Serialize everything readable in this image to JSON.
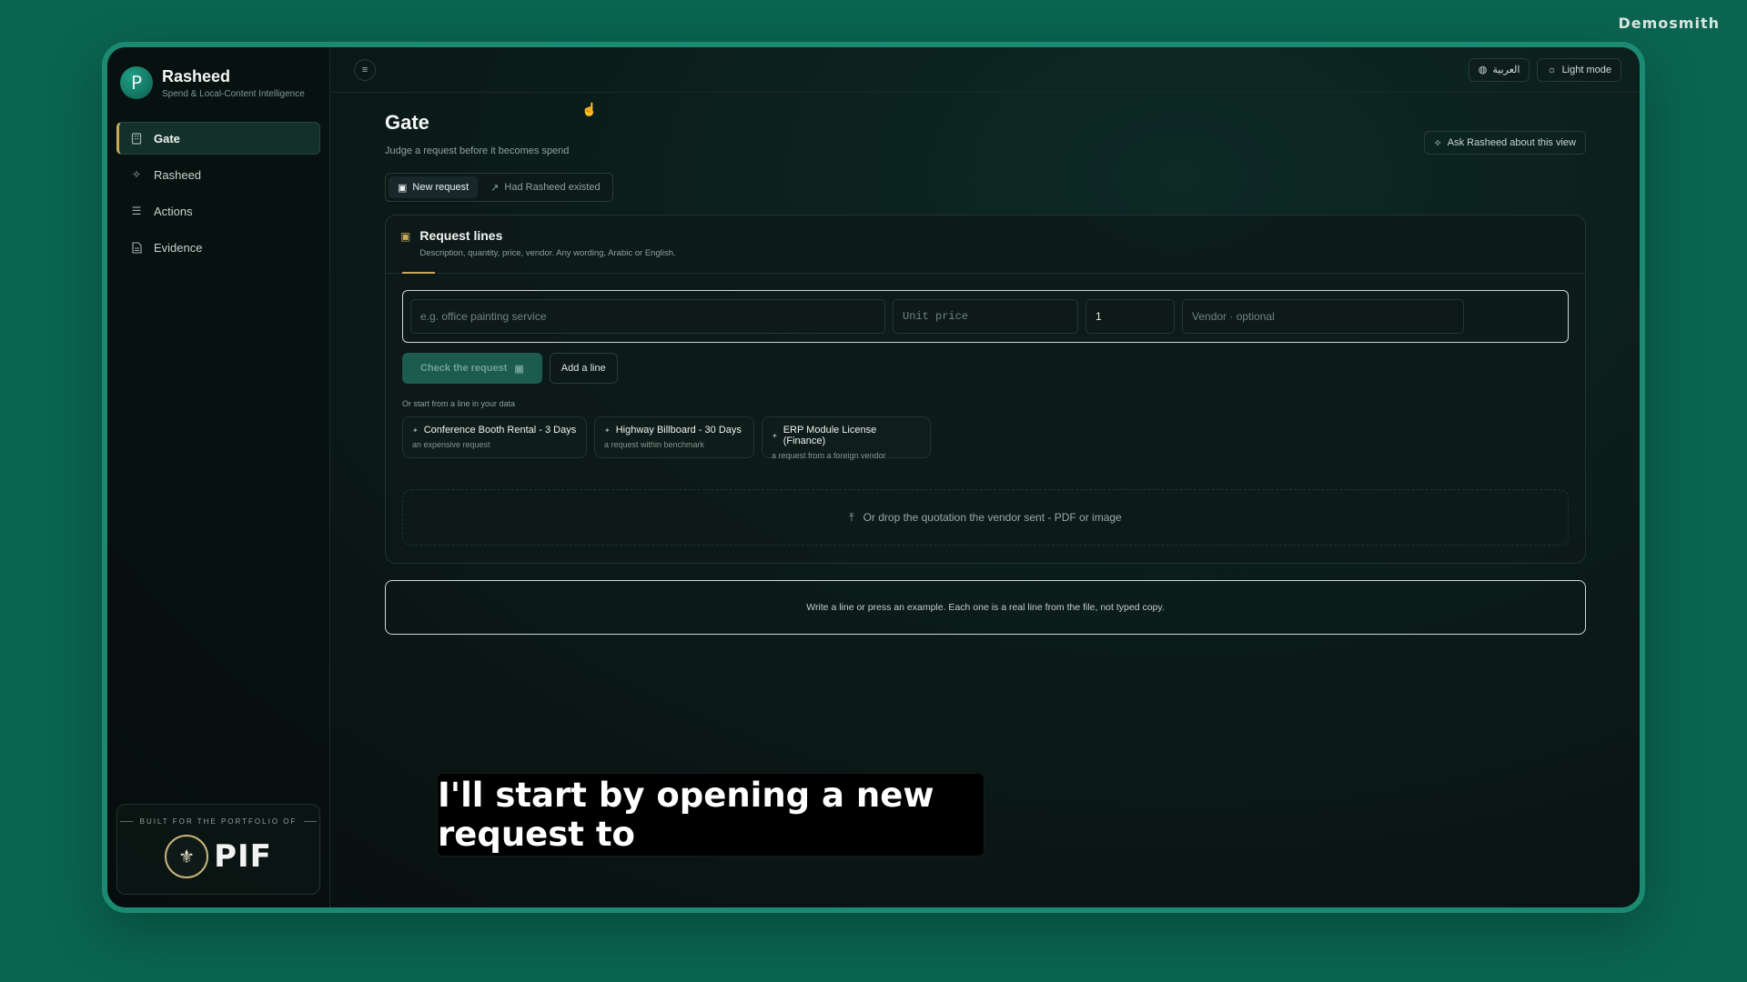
{
  "watermark": "Demosmith",
  "brand": {
    "initial": "P",
    "name": "Rasheed",
    "subtitle": "Spend & Local-Content Intelligence"
  },
  "sidebar": {
    "items": [
      {
        "label": "Gate",
        "icon": "building-icon",
        "active": true
      },
      {
        "label": "Rasheed",
        "icon": "sparkle-icon",
        "active": false
      },
      {
        "label": "Actions",
        "icon": "list-filter-icon",
        "active": false
      },
      {
        "label": "Evidence",
        "icon": "document-icon",
        "active": false
      }
    ],
    "portfolio_caption": "BUILT FOR THE PORTFOLIO OF",
    "portfolio_logo": "PIF"
  },
  "topbar": {
    "language_label": "العربية",
    "theme_label": "Light mode"
  },
  "page": {
    "title": "Gate",
    "subtitle": "Judge a request before it becomes spend",
    "ask_label": "Ask Rasheed about this view"
  },
  "tabs": [
    {
      "label": "New request",
      "active": true
    },
    {
      "label": "Had Rasheed existed",
      "active": false
    }
  ],
  "request_card": {
    "title": "Request lines",
    "subtitle": "Description, quantity, price, vendor. Any wording, Arabic or English.",
    "fields": {
      "description_placeholder": "e.g. office painting service",
      "unit_price_placeholder": "Unit price",
      "quantity_value": "1",
      "vendor_placeholder": "Vendor · optional"
    },
    "check_label": "Check the request",
    "add_line_label": "Add a line",
    "examples_label": "Or start from a line in your data",
    "examples": [
      {
        "title": "Conference Booth Rental - 3 Days",
        "subtitle": "an expensive request"
      },
      {
        "title": "Highway Billboard - 30 Days",
        "subtitle": "a request within benchmark"
      },
      {
        "title": "ERP Module License (Finance)",
        "subtitle": "a request from a foreign vendor"
      }
    ],
    "dropzone_label": "Or drop the quotation the vendor sent - PDF or image"
  },
  "note": "Write a line or press an example. Each one is a real line from the file, not typed copy.",
  "caption": "I'll start by opening a new request to",
  "colors": {
    "accent_gold": "#c9a85a",
    "brand_green": "#0a6450",
    "primary_button": "#1b5c4e"
  }
}
